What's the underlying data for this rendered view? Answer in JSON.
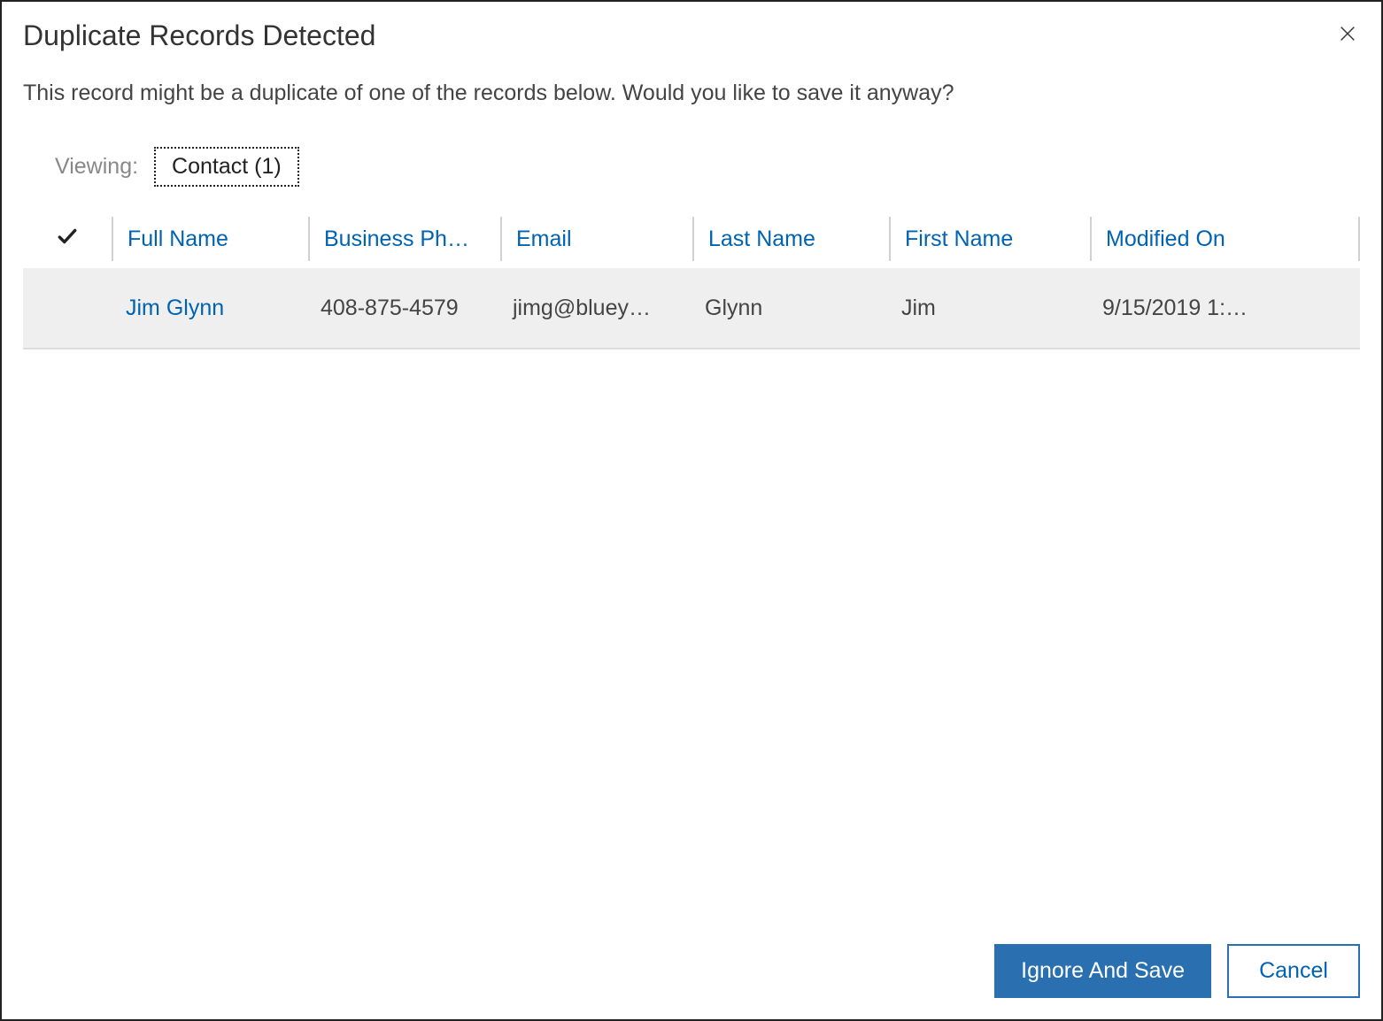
{
  "dialog": {
    "title": "Duplicate Records Detected",
    "message": "This record might be a duplicate of one of the records below. Would you like to save it anyway?"
  },
  "viewing": {
    "label": "Viewing:",
    "tab": "Contact (1)"
  },
  "grid": {
    "columns": {
      "fullname": "Full Name",
      "phone": "Business Ph…",
      "email": "Email",
      "lastname": "Last Name",
      "firstname": "First Name",
      "modified": "Modified On"
    },
    "rows": [
      {
        "fullname": "Jim Glynn",
        "phone": "408-875-4579",
        "email": "jimg@bluey…",
        "lastname": "Glynn",
        "firstname": "Jim",
        "modified": "9/15/2019 1:…"
      }
    ]
  },
  "footer": {
    "primary": "Ignore And Save",
    "secondary": "Cancel"
  }
}
